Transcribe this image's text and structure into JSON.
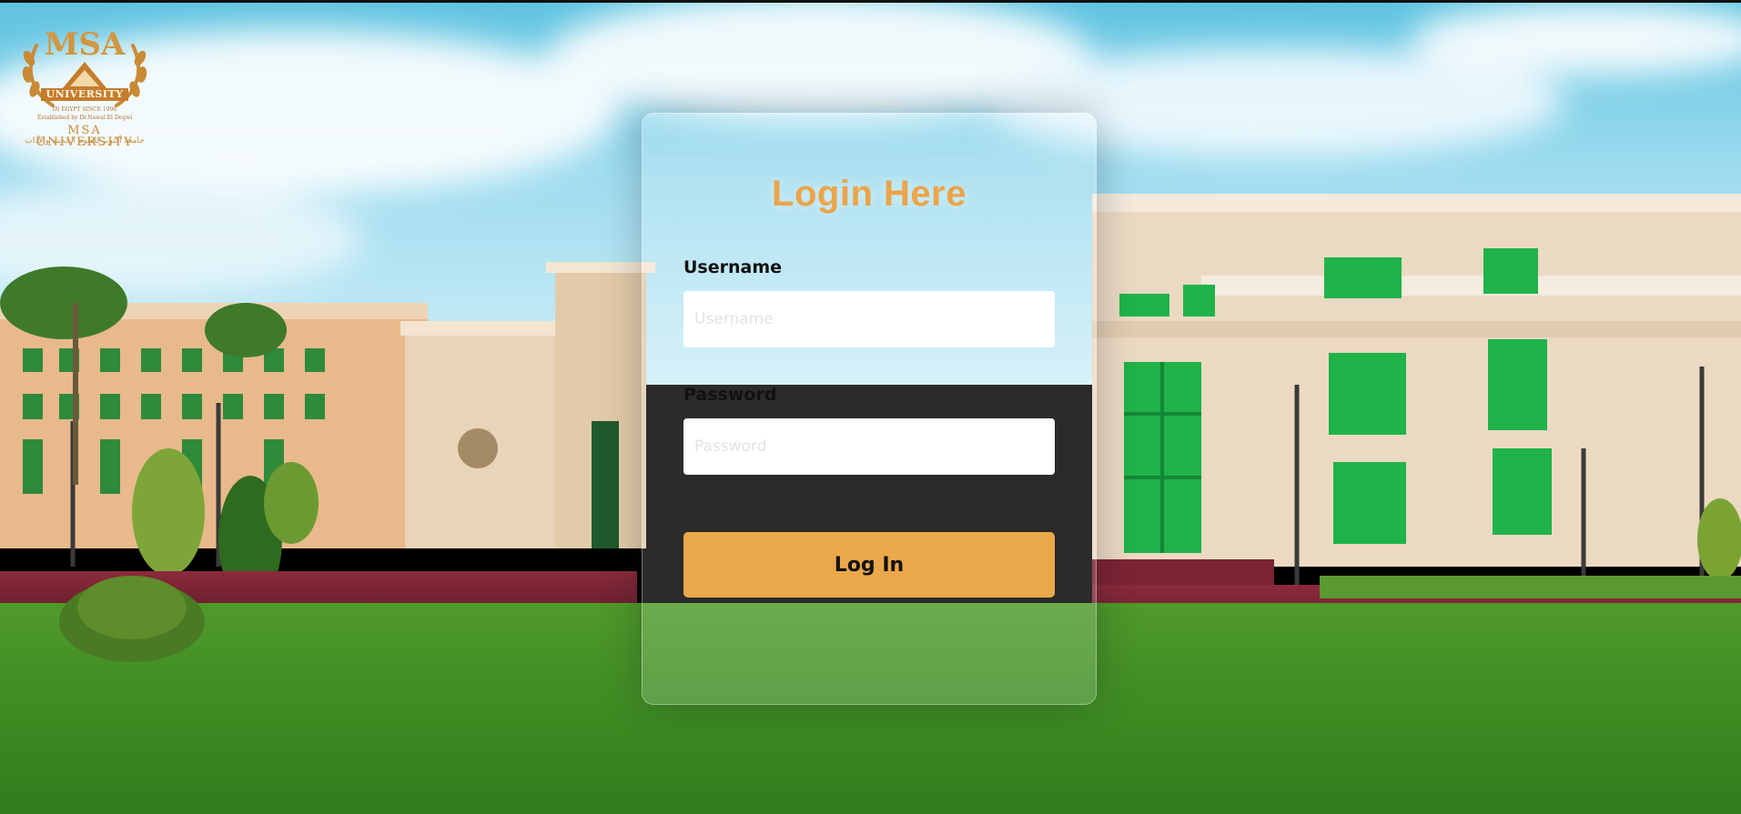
{
  "logo": {
    "monogram": "MSA",
    "ribbon": "UNIVERSITY",
    "line1": "IN EGYPT SINCE 1996",
    "line2": "Established by Dr.Nawal El Degwi",
    "name": "MSA UNIVERSITY",
    "arabic": "جامعة أكتوبر للعلوم الحديثة والآداب"
  },
  "login": {
    "title": "Login Here",
    "username_label": "Username",
    "username_placeholder": "Username",
    "username_value": "",
    "password_label": "Password",
    "password_placeholder": "Password",
    "password_value": "",
    "submit_label": "Log In"
  },
  "colors": {
    "accent": "#eba84a",
    "title": "#eba44a"
  }
}
